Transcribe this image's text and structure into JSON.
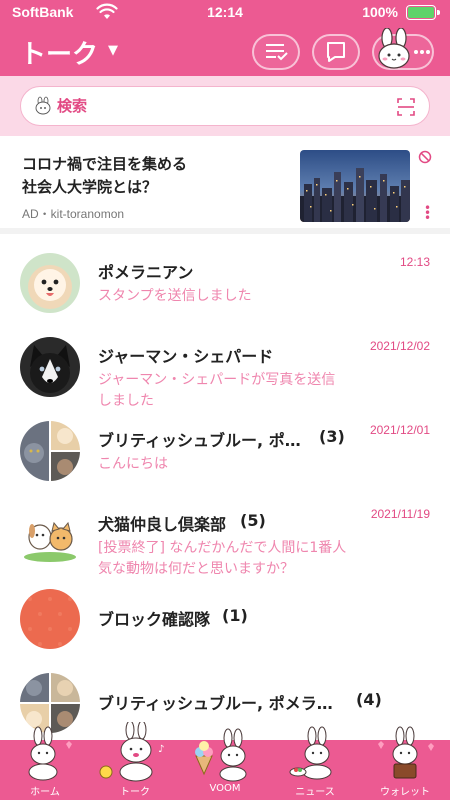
{
  "status": {
    "carrier": "SoftBank",
    "time": "12:14",
    "battery": "100%",
    "battery_level": 1.0
  },
  "header": {
    "title": "トーク"
  },
  "search": {
    "placeholder": "検索"
  },
  "ad": {
    "title_line1": "コロナ禍で注目を集める",
    "title_line2": "社会人大学院とは？",
    "sponsor": "AD・kit-toranomon"
  },
  "chats": [
    {
      "name": "ポメラニアン",
      "count": "",
      "preview": "スタンプを送信しました",
      "date": "12:13"
    },
    {
      "name": "ジャーマン・シェパード",
      "count": "",
      "preview": "ジャーマン・シェパードが写真を送信しました",
      "date": "2021/12/02"
    },
    {
      "name": "ブリティッシュブルー, ポ…",
      "count": "(3)",
      "preview": "こんにちは",
      "date": "2021/12/01"
    },
    {
      "name": "犬猫仲良し倶楽部",
      "count": "(5)",
      "preview": "[投票終了] なんだかんだで人間に1番人気な動物は何だと思いますか？",
      "date": "2021/11/19"
    },
    {
      "name": "ブロック確認隊",
      "count": "(1)",
      "preview": "",
      "date": ""
    },
    {
      "name": "ブリティッシュブルー, ポメラ…",
      "count": "(4)",
      "preview": "",
      "date": ""
    }
  ],
  "tabs": [
    {
      "label": "ホーム"
    },
    {
      "label": "トーク"
    },
    {
      "label": "VOOM"
    },
    {
      "label": "ニュース"
    },
    {
      "label": "ウォレット"
    }
  ],
  "colors": {
    "brand": "#ec5a92",
    "preview_text": "#ef86ae",
    "date_text": "#e24a84"
  }
}
